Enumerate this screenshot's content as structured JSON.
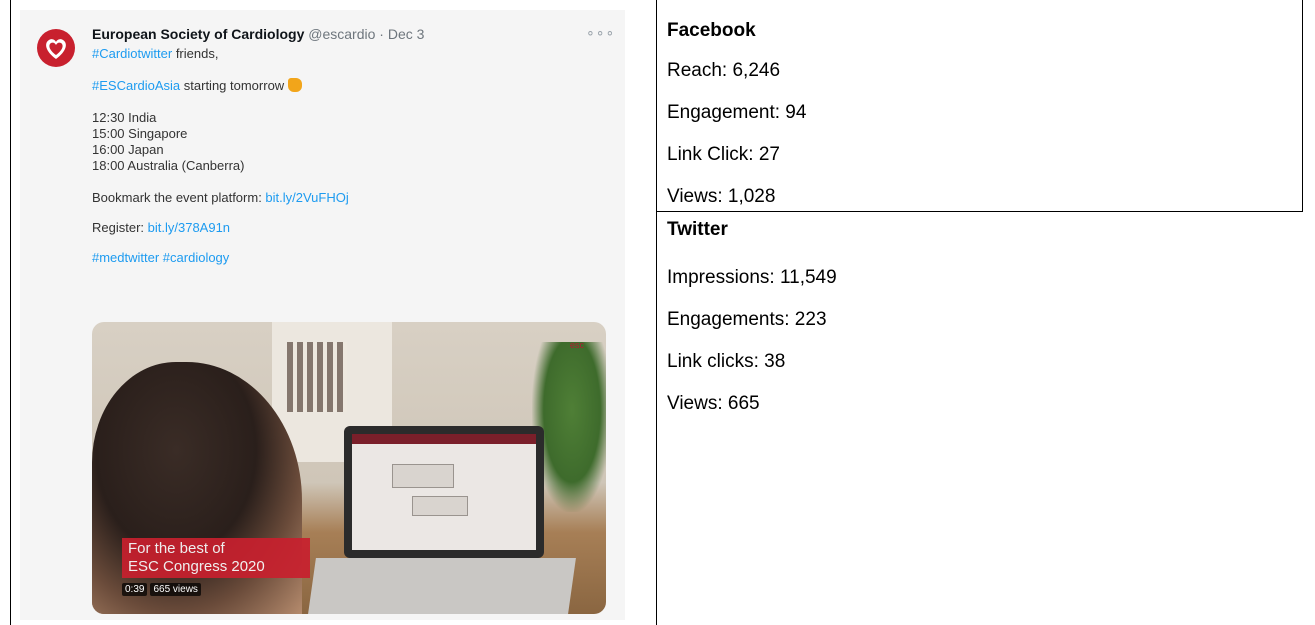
{
  "tweet": {
    "author_name": "European Society of Cardiology",
    "handle": "@escardio",
    "separator": "·",
    "date": "Dec 3",
    "more_label": "∘∘∘",
    "line1_tag": "#Cardiotwitter",
    "line1_text": " friends,",
    "line2_tag": "#ESCardioAsia",
    "line2_text": " starting tomorrow",
    "schedule": [
      "12:30 India",
      "15:00 Singapore",
      "16:00 Japan",
      "18:00 Australia (Canberra)"
    ],
    "bookmark_text": "Bookmark the event platform: ",
    "bookmark_link": "bit.ly/2VuFHOj",
    "register_text": "Register: ",
    "register_link": "bit.ly/378A91n",
    "hashtags": "#medtwitter #cardiology",
    "media": {
      "overlay_line1": "For the best of",
      "overlay_line2": "ESC Congress 2020",
      "duration": "0:39",
      "views": "665 views",
      "logo_text": "esc"
    },
    "colors": {
      "link": "#1d9bf0",
      "logo_red": "#c8202e"
    }
  },
  "facebook": {
    "title": "Facebook",
    "reach": "Reach:  6,246",
    "engagement": "Engagement: 94",
    "link_click": "Link Click: 27",
    "views": "Views: 1,028"
  },
  "twitter": {
    "title": "Twitter",
    "impressions": "Impressions: 11,549",
    "engagements": "Engagements: 223",
    "link_clicks": "Link clicks: 38",
    "views": "Views: 665"
  }
}
